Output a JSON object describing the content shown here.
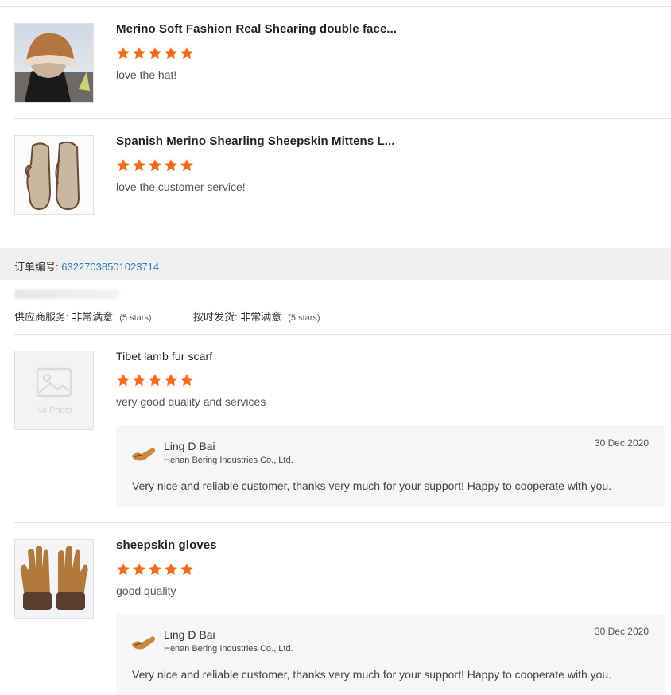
{
  "reviews_top": [
    {
      "title": "Merino Soft Fashion Real Shearing double face...",
      "rating": 5,
      "comment": "love the hat!",
      "image_icon": "hat-photo"
    },
    {
      "title": "Spanish Merino Shearling Sheepskin Mittens L...",
      "rating": 5,
      "comment": "love the customer service!",
      "image_icon": "mittens-photo"
    }
  ],
  "order": {
    "label": "订单编号: ",
    "number": "63227038501023714",
    "supplier_service_label": "供应商服务: ",
    "supplier_service_value": "非常满意",
    "supplier_service_stars": "(5 stars)",
    "on_time_label": "按时发货: ",
    "on_time_value": "非常满意",
    "on_time_stars": "(5 stars)"
  },
  "reviews_bottom": [
    {
      "title": "Tibet lamb fur scarf",
      "rating": 5,
      "comment": "very good quality and services",
      "no_photo_text": "No Photo",
      "reply": {
        "name": "Ling D Bai",
        "company": "Henan Bering Industries Co., Ltd.",
        "date": "30 Dec 2020",
        "text": "Very nice and reliable customer, thanks very much for your support! Happy to cooperate with you."
      }
    },
    {
      "title": "sheepskin gloves",
      "rating": 5,
      "comment": "good quality",
      "reply": {
        "name": "Ling D Bai",
        "company": "Henan Bering Industries Co., Ltd.",
        "date": "30 Dec 2020",
        "text": "Very nice and reliable customer, thanks very much for your support! Happy to cooperate with you."
      }
    }
  ],
  "colors": {
    "star": "#f56a1f",
    "link": "#2d7fc1",
    "order_bar": "#efefef",
    "reply_bg": "#f5f6f7"
  }
}
